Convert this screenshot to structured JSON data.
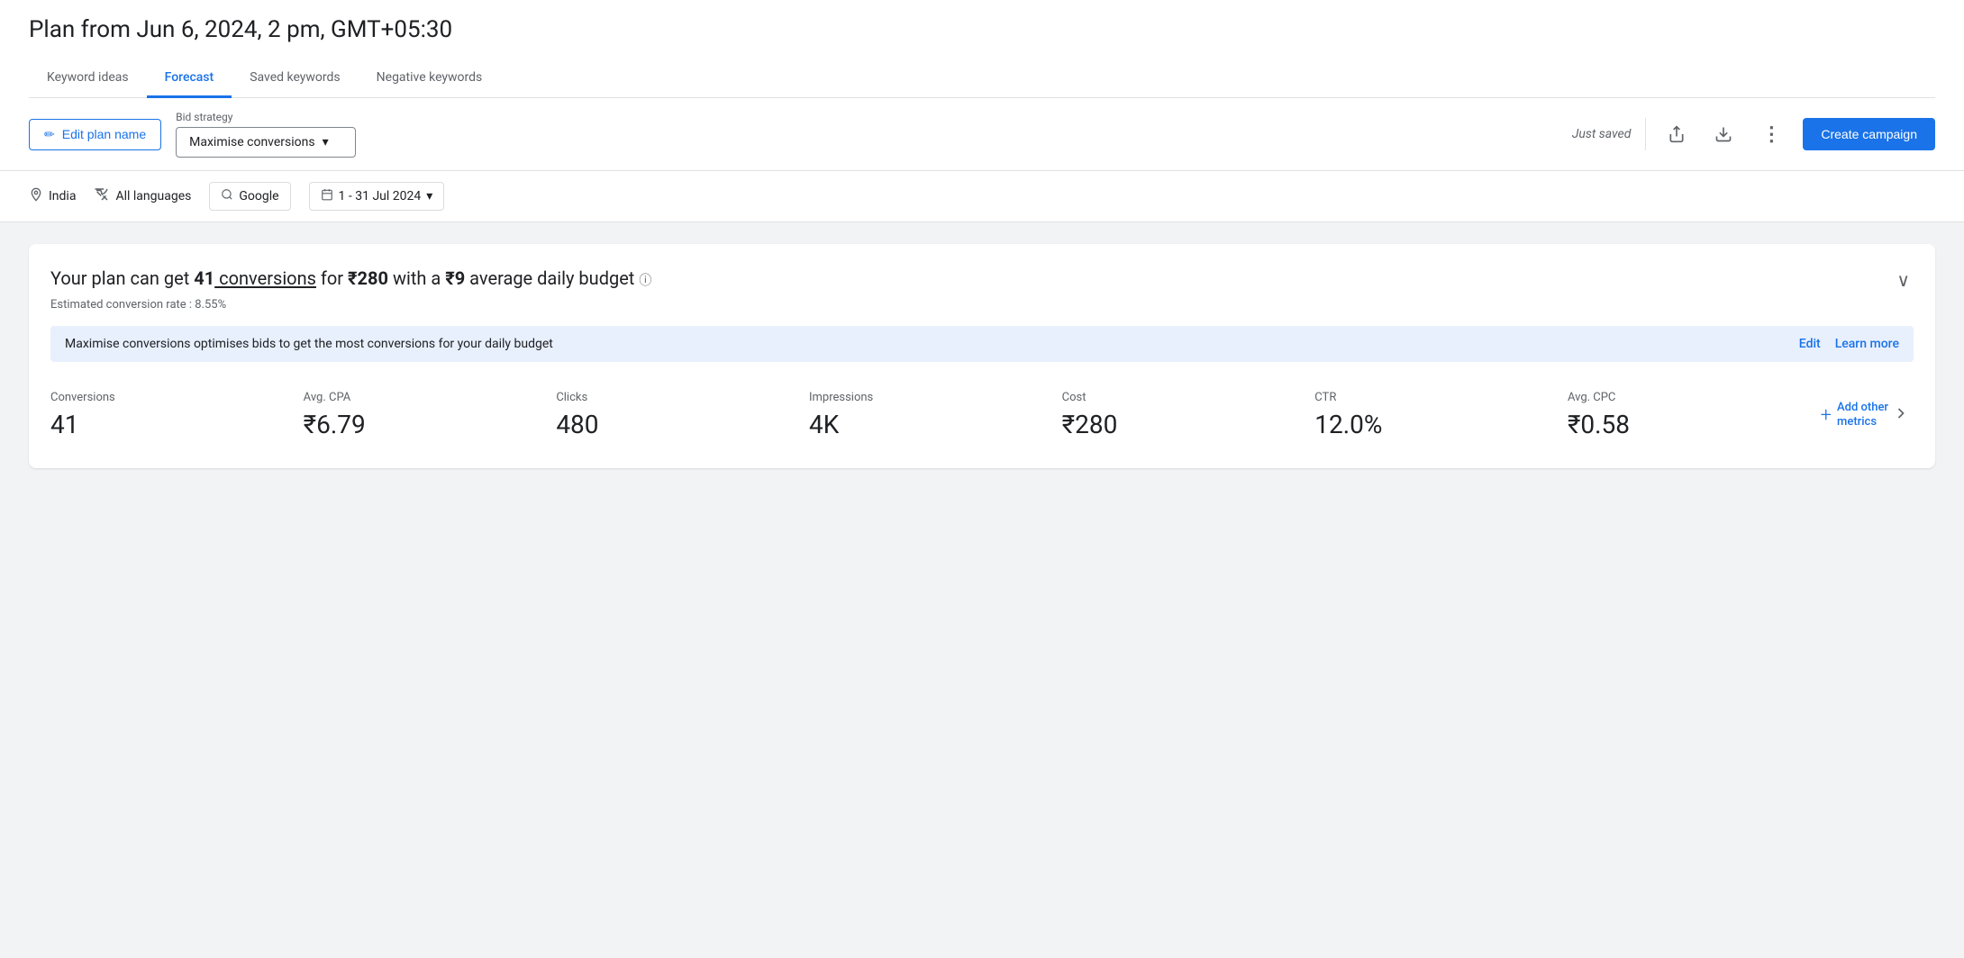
{
  "plan": {
    "title": "Plan from Jun 6, 2024, 2 pm, GMT+05:30"
  },
  "tabs": [
    {
      "id": "keyword-ideas",
      "label": "Keyword ideas",
      "active": false
    },
    {
      "id": "forecast",
      "label": "Forecast",
      "active": true
    },
    {
      "id": "saved-keywords",
      "label": "Saved keywords",
      "active": false
    },
    {
      "id": "negative-keywords",
      "label": "Negative keywords",
      "active": false
    }
  ],
  "toolbar": {
    "edit_plan_label": "Edit plan name",
    "bid_strategy_label": "Bid strategy",
    "bid_strategy_value": "Maximise conversions",
    "just_saved": "Just saved",
    "create_campaign_label": "Create campaign"
  },
  "filters": {
    "location": "India",
    "language": "All languages",
    "network": "Google",
    "date_range": "1 - 31 Jul 2024"
  },
  "forecast": {
    "headline_prefix": "Your plan can get ",
    "conversions_count": "41",
    "headline_mid1": " conversions",
    "headline_mid2": " for ",
    "cost": "₹280",
    "headline_mid3": " with a ",
    "daily_budget": "₹9",
    "headline_suffix": " average daily budget",
    "conversion_rate_label": "Estimated conversion rate : 8.55%",
    "info_banner_text": "Maximise conversions optimises bids to get the most conversions for your daily budget",
    "edit_link": "Edit",
    "learn_more_link": "Learn more",
    "collapse_icon": "chevron-down"
  },
  "metrics": [
    {
      "label": "Conversions",
      "value": "41"
    },
    {
      "label": "Avg. CPA",
      "value": "₹6.79"
    },
    {
      "label": "Clicks",
      "value": "480"
    },
    {
      "label": "Impressions",
      "value": "4K"
    },
    {
      "label": "Cost",
      "value": "₹280"
    },
    {
      "label": "CTR",
      "value": "12.0%"
    },
    {
      "label": "Avg. CPC",
      "value": "₹0.58"
    }
  ],
  "add_metrics": {
    "label": "Add other metrics"
  },
  "icons": {
    "edit": "✏",
    "upload": "↑",
    "download": "↓",
    "more_vert": "⋮",
    "location": "📍",
    "translate": "A̲",
    "search": "⚲",
    "calendar": "📅",
    "dropdown": "▾",
    "chevron_down": "∨",
    "plus": "+"
  }
}
